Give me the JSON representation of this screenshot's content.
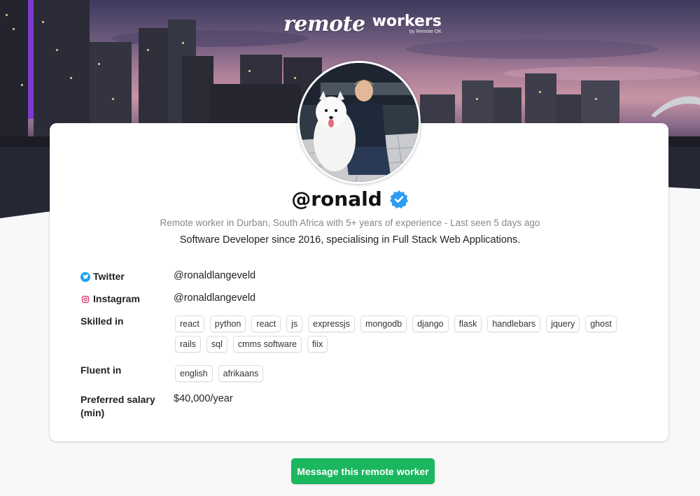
{
  "brand": {
    "script": "remote",
    "word": "workers",
    "by": "by Remote OK"
  },
  "profile": {
    "username": "@ronald",
    "verified": true,
    "subtitle": "Remote worker in Durban, South Africa with 5+ years of experience - Last seen 5 days ago",
    "bio": "Software Developer since 2016, specialising in Full Stack Web Applications."
  },
  "details": {
    "twitter_label": "Twitter",
    "twitter_value": "@ronaldlangeveld",
    "instagram_label": "Instagram",
    "instagram_value": "@ronaldlangeveld",
    "skills_label": "Skilled in",
    "skills": [
      "react",
      "python",
      "react",
      "js",
      "expressjs",
      "mongodb",
      "django",
      "flask",
      "handlebars",
      "jquery",
      "ghost",
      "rails",
      "sql",
      "cmms software",
      "fiix"
    ],
    "languages_label": "Fluent in",
    "languages": [
      "english",
      "afrikaans"
    ],
    "salary_label": "Preferred salary (min)",
    "salary_value": "$40,000/year"
  },
  "cta": {
    "label": "Message this remote worker"
  },
  "colors": {
    "cta": "#1bb75f",
    "verified": "#2d9cf0",
    "twitter": "#1da1f2",
    "instagram": "#e1306c"
  },
  "icons": [
    "verified-badge-icon",
    "twitter-icon",
    "instagram-icon"
  ]
}
